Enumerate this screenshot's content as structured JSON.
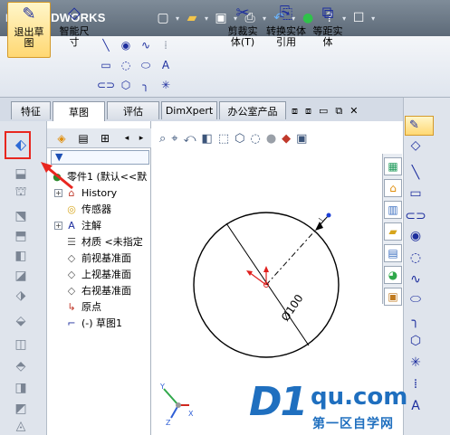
{
  "app": {
    "name": "SOLIDWORKS",
    "logo_prefix": "DS"
  },
  "ribbon": {
    "exit_sketch": "退出草图",
    "smart_dimension": "智能尺寸",
    "trim": "剪裁实体(T)",
    "convert": "转换实体引用",
    "offset": "等距实体"
  },
  "tabs": [
    "特征",
    "草图",
    "评估",
    "DimXpert",
    "办公室产品"
  ],
  "active_tab": "草图",
  "tree": {
    "root": "零件1 (默认<<默",
    "items": [
      {
        "label": "History",
        "icon": "history-icon",
        "expand": "+"
      },
      {
        "label": "传感器",
        "icon": "sensor-icon",
        "expand": ""
      },
      {
        "label": "注解",
        "icon": "annotation-icon",
        "expand": "+"
      },
      {
        "label": "材质 <未指定",
        "icon": "material-icon",
        "expand": ""
      },
      {
        "label": "前视基准面",
        "icon": "plane-icon",
        "expand": ""
      },
      {
        "label": "上视基准面",
        "icon": "plane-icon",
        "expand": ""
      },
      {
        "label": "右视基准面",
        "icon": "plane-icon",
        "expand": ""
      },
      {
        "label": "原点",
        "icon": "origin-icon",
        "expand": ""
      },
      {
        "label": "(-) 草图1",
        "icon": "sketch-icon",
        "expand": ""
      }
    ]
  },
  "sketch": {
    "dimension": "Ø100"
  },
  "triad": {
    "x": "X",
    "y": "Y",
    "z": "Z"
  },
  "watermark": {
    "brand": "D1",
    "url": "qu.com",
    "slogan": "第一区自学网"
  },
  "colors": {
    "highlight": "#e8261f",
    "accent": "#1d2e9e",
    "watermark": "#1f6fbf"
  }
}
